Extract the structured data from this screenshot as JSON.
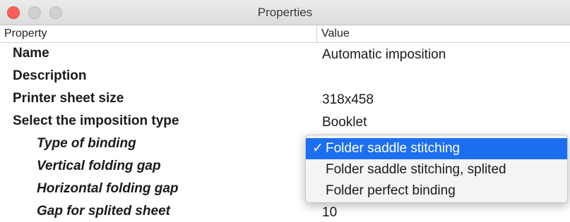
{
  "window": {
    "title": "Properties"
  },
  "table": {
    "header_property": "Property",
    "header_value": "Value",
    "rows": [
      {
        "property": "Name",
        "value": "Automatic imposition"
      },
      {
        "property": "Description",
        "value": ""
      },
      {
        "property": "Printer sheet size",
        "value": "318x458"
      },
      {
        "property": "Select the imposition type",
        "value": "Booklet"
      },
      {
        "property": "Type of binding",
        "value": ""
      },
      {
        "property": "Vertical folding gap",
        "value": ""
      },
      {
        "property": "Horizontal folding gap",
        "value": ""
      },
      {
        "property": "Gap for splited sheet",
        "value": "10"
      }
    ]
  },
  "dropdown": {
    "check_mark": "✓",
    "options": [
      {
        "label": "Folder saddle stitching",
        "selected": true
      },
      {
        "label": "Folder saddle stitching, splited",
        "selected": false
      },
      {
        "label": "Folder perfect binding",
        "selected": false
      }
    ]
  },
  "colors": {
    "selection": "#1d6ff2",
    "close_button": "#fc605c"
  }
}
